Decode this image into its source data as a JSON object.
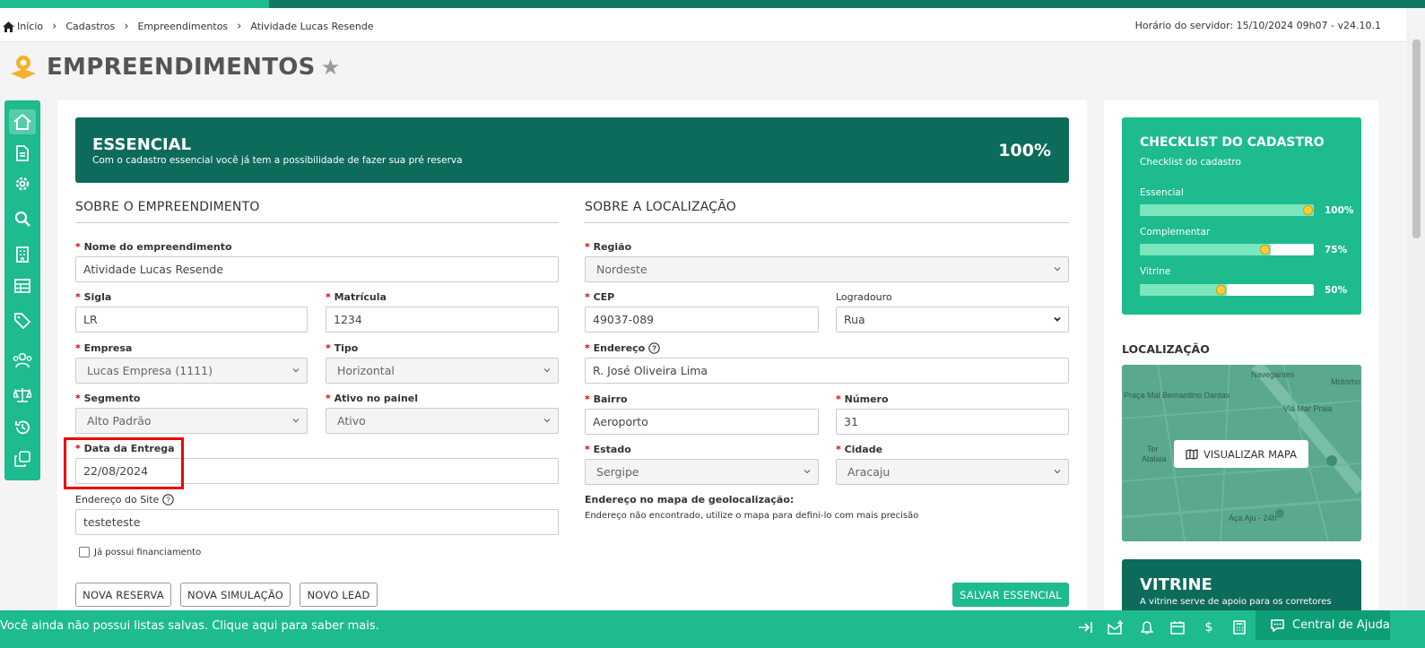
{
  "breadcrumb": {
    "home": "Início",
    "items": [
      "Cadastros",
      "Empreendimentos",
      "Atividade Lucas Resende"
    ]
  },
  "server_time": "Horário do servidor: 15/10/2024 09h07 - v24.10.1",
  "page_title": "EMPREENDIMENTOS",
  "banner": {
    "title": "ESSENCIAL",
    "subtitle": "Com o cadastro essencial você já tem a possibilidade de fazer sua pré reserva",
    "percent": "100%"
  },
  "left_section": {
    "title": "SOBRE O EMPREENDIMENTO",
    "nome_label": "Nome do empreendimento",
    "nome_value": "Atividade Lucas Resende",
    "sigla_label": "Sigla",
    "sigla_value": "LR",
    "matricula_label": "Matrícula",
    "matricula_value": "1234",
    "empresa_label": "Empresa",
    "empresa_value": "Lucas Empresa (1111)",
    "tipo_label": "Tipo",
    "tipo_value": "Horizontal",
    "segmento_label": "Segmento",
    "segmento_value": "Alto Padrão",
    "ativo_label": "Ativo no painel",
    "ativo_value": "Ativo",
    "entrega_label": "Data da Entrega",
    "entrega_value": "22/08/2024",
    "site_label": "Endereço do Site",
    "site_value": "testeteste",
    "financ_label": "Já possui financiamento"
  },
  "right_section": {
    "title": "SOBRE A LOCALIZAÇÃO",
    "regiao_label": "Região",
    "regiao_value": "Nordeste",
    "cep_label": "CEP",
    "cep_value": "49037-089",
    "logradouro_label": "Logradouro",
    "logradouro_value": "Rua",
    "endereco_label": "Endereço",
    "endereco_value": "R. José Oliveira Lima",
    "bairro_label": "Bairro",
    "bairro_value": "Aeroporto",
    "numero_label": "Número",
    "numero_value": "31",
    "estado_label": "Estado",
    "estado_value": "Sergipe",
    "cidade_label": "Cidade",
    "cidade_value": "Aracaju",
    "geo_title": "Endereço no mapa de geolocalização:",
    "geo_text": "Endereço não encontrado, utilize o mapa para defini-lo com mais precisão"
  },
  "buttons": {
    "nova_reserva": "NOVA RESERVA",
    "nova_simulacao": "NOVA SIMULAÇÃO",
    "novo_lead": "NOVO LEAD",
    "salvar": "SALVAR ESSENCIAL"
  },
  "checklist": {
    "title": "CHECKLIST DO CADASTRO",
    "subtitle": "Checklist do cadastro",
    "rows": [
      {
        "label": "Essencial",
        "percent": "100%",
        "value": 1.0
      },
      {
        "label": "Complementar",
        "percent": "75%",
        "value": 0.75
      },
      {
        "label": "Vitrine",
        "percent": "50%",
        "value": 0.5
      }
    ]
  },
  "location": {
    "title": "LOCALIZAÇÃO",
    "map_button": "VISUALIZAR MAPA",
    "map_labels": [
      "Praça Mal Bernardino Dantas",
      "Via Mar Praia",
      "Atalaia",
      "Aça Aju - 24h",
      "Motorho",
      "Ter",
      "Navegantes"
    ]
  },
  "vitrine": {
    "title": "VITRINE",
    "subtitle": "A vitrine serve de apoio para os corretores"
  },
  "bottom": {
    "message": "Você ainda não possui listas salvas. Clique aqui para saber mais.",
    "help": "Central de Ajuda",
    "currency": "$"
  },
  "colors": {
    "accent": "#1dbb8e",
    "dark": "#0d6b5b",
    "highlight": "#e00000"
  }
}
